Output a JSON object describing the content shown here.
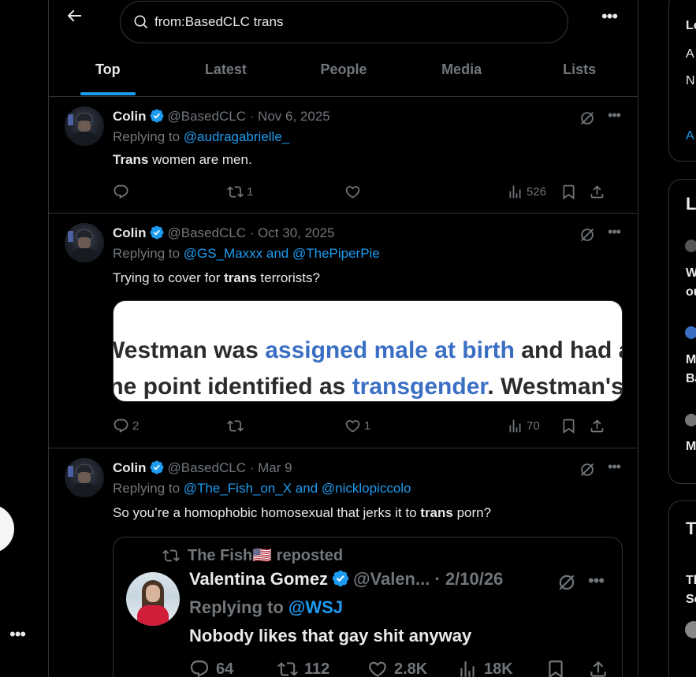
{
  "search": {
    "query": "from:BasedCLC trans"
  },
  "tabs": [
    {
      "label": "Top",
      "active": true
    },
    {
      "label": "Latest"
    },
    {
      "label": "People"
    },
    {
      "label": "Media"
    },
    {
      "label": "Lists"
    }
  ],
  "tweets": [
    {
      "name": "Colin",
      "handle_date": "@BasedCLC · Nov 6, 2025",
      "replying_prefix": "Replying to ",
      "replying_to": "@audragabrielle_",
      "text_bold": "Trans",
      "text_rest": " women are men.",
      "replies": "",
      "reposts": "1",
      "likes": "",
      "views": "526"
    },
    {
      "name": "Colin",
      "handle_date": "@BasedCLC · Oct 30, 2025",
      "replying_prefix": "Replying to ",
      "replying_to": "@GS_Maxxx and @ThePiperPie",
      "text_pre": "Trying to cover for ",
      "text_bold": "trans",
      "text_rest": " terrorists?",
      "media_line1_a": "Westman was ",
      "media_line1_b": "assigned male at birth",
      "media_line1_c": " and had at",
      "media_line2_a": "one point identified as ",
      "media_line2_b": "transgender",
      "media_line2_c": ". Westman's",
      "replies": "2",
      "reposts": "",
      "likes": "1",
      "views": "70"
    },
    {
      "name": "Colin",
      "handle_date": "@BasedCLC · Mar 9",
      "replying_prefix": "Replying to ",
      "replying_to": "@The_Fish_on_X and @nicklopiccolo",
      "text_pre": "So you’re a homophobic homosexual that jerks it to ",
      "text_bold": "trans",
      "text_rest": " porn?",
      "quote": {
        "reposted_by": "The Fish🇺🇸 reposted",
        "name": "Valentina Gomez",
        "handle_date": "@Valen... · 2/10/26",
        "replying_prefix": "Replying to ",
        "replying_to": "@WSJ",
        "text": "Nobody likes that gay shit anyway",
        "replies": "64",
        "reposts": "112",
        "likes": "2.8K",
        "views": "18K"
      }
    }
  ],
  "right_column": {
    "card1": [
      "Le",
      "A",
      "N",
      "A"
    ],
    "card2": [
      "L",
      "W",
      "ou",
      "M",
      "Ba",
      "M"
    ],
    "card3": [
      "T",
      "Th",
      "Se"
    ]
  },
  "colors": {
    "accent": "#1d9bf0",
    "muted": "#71767b",
    "border": "#2f3336",
    "text": "#e7e9ea"
  }
}
